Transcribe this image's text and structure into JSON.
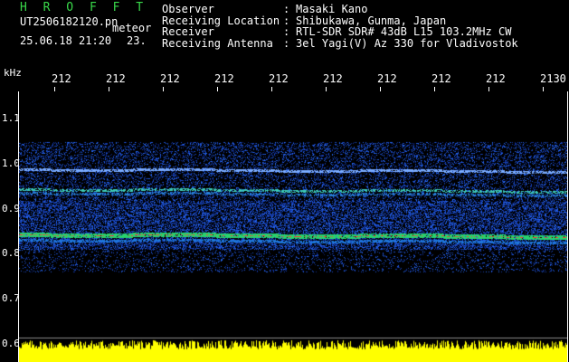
{
  "header": {
    "brand": "H R O F F T",
    "filename": "UT2506182120.pn",
    "meteor_label": "meteor",
    "datetime": "25.06.18 21:20",
    "count": "23.",
    "info": [
      {
        "key": "Observer",
        "value": "Masaki Kano"
      },
      {
        "key": "Receiving Location",
        "value": "Shibukawa, Gunma, Japan"
      },
      {
        "key": "Receiver",
        "value": "RTL-SDR SDR# 43dB L15 103.2MHz CW"
      },
      {
        "key": "Receiving Antenna",
        "value": "3el Yagi(V) Az 330 for Vladivostok"
      }
    ]
  },
  "axes": {
    "y_unit": "kHz",
    "y_ticks": [
      "1.1",
      "1.0",
      "0.9",
      "0.8",
      "0.7",
      "0.6"
    ],
    "x_ticks": [
      "212",
      "212",
      "212",
      "212",
      "212",
      "212",
      "212",
      "212",
      "212",
      "2130"
    ]
  },
  "colors": {
    "brand": "#39d84a",
    "background": "#000000",
    "signal_low": "#0a2a9e",
    "signal_mid": "#22c07a",
    "signal_high": "#ff3030",
    "power_bar": "#ffff00"
  }
}
